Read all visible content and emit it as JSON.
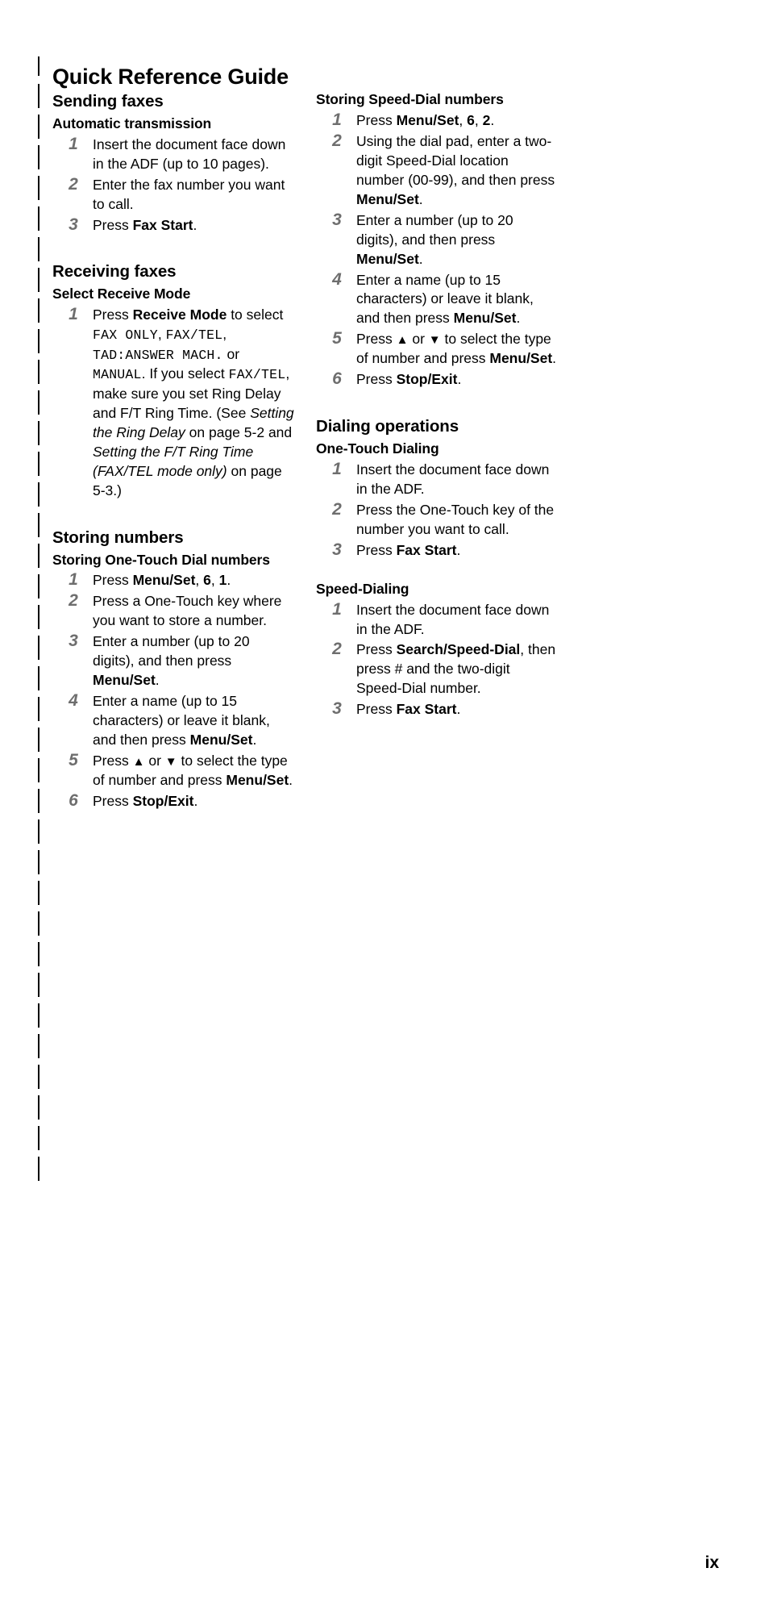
{
  "document": {
    "title": "Quick Reference Guide",
    "page_number": "ix"
  },
  "left_column": {
    "sections": [
      {
        "heading": "Sending faxes",
        "subheading": "Automatic transmission",
        "steps": [
          {
            "num": "1",
            "text": "Insert the document face down in the ADF (up to 10 pages)."
          },
          {
            "num": "2",
            "text": "Enter the fax number you want to call."
          },
          {
            "num": "3",
            "text": "Press Fax Start."
          }
        ]
      },
      {
        "heading": "Receiving faxes",
        "subheading": "Select Receive Mode",
        "steps": [
          {
            "num": "1",
            "text": "Press Receive Mode to select FAX ONLY, FAX/TEL, TAD:ANSWER MACH. or MANUAL. If you select FAX/TEL, make sure you set Ring Delay and F/T Ring Time. (See Setting the Ring Delay on page 5-2 and Setting the F/T Ring Time (FAX/TEL mode only) on page 5-3.)"
          }
        ]
      },
      {
        "heading": "Storing numbers",
        "subheading": "Storing One-Touch Dial numbers",
        "steps": [
          {
            "num": "1",
            "text": "Press Menu/Set, 6, 1."
          },
          {
            "num": "2",
            "text": "Press a One-Touch key where you want to store a number."
          },
          {
            "num": "3",
            "text": "Enter a number (up to 20 digits), and then press Menu/Set."
          },
          {
            "num": "4",
            "text": "Enter a name (up to 15 characters) or leave it blank, and then press Menu/Set."
          },
          {
            "num": "5",
            "text": "Press ▲ or ▼ to select the type of number and press Menu/Set."
          },
          {
            "num": "6",
            "text": "Press Stop/Exit."
          }
        ]
      }
    ]
  },
  "right_column": {
    "sections": [
      {
        "heading": "",
        "subheading": "Storing Speed-Dial numbers",
        "steps": [
          {
            "num": "1",
            "text": "Press Menu/Set, 6, 2."
          },
          {
            "num": "2",
            "text": "Using the dial pad, enter a two-digit Speed-Dial location number (00-99), and then press Menu/Set."
          },
          {
            "num": "3",
            "text": "Enter a number (up to 20 digits), and then press Menu/Set."
          },
          {
            "num": "4",
            "text": "Enter a name (up to 15 characters) or leave it blank, and then press Menu/Set."
          },
          {
            "num": "5",
            "text": "Press ▲ or ▼ to select the type of number and press Menu/Set."
          },
          {
            "num": "6",
            "text": "Press Stop/Exit."
          }
        ]
      },
      {
        "heading": "Dialing operations",
        "subheading": "One-Touch Dialing",
        "steps": [
          {
            "num": "1",
            "text": "Insert the document face down in the ADF."
          },
          {
            "num": "2",
            "text": "Press the One-Touch key of the number you want to call."
          },
          {
            "num": "3",
            "text": "Press Fax Start."
          }
        ]
      },
      {
        "heading": "",
        "subheading": "Speed-Dialing",
        "steps": [
          {
            "num": "1",
            "text": "Insert the document face down in the ADF."
          },
          {
            "num": "2",
            "text": "Press Search/Speed-Dial, then press # and the two-digit Speed-Dial number."
          },
          {
            "num": "3",
            "text": "Press Fax Start."
          }
        ]
      }
    ]
  },
  "labels": {
    "section_sending": "Sending faxes",
    "section_receiving": "Receiving faxes",
    "section_storing": "Storing numbers",
    "section_dialing": "Dialing operations",
    "sub_automatic": "Automatic transmission",
    "sub_select_receive": "Select Receive Mode",
    "sub_one_touch_store": "Storing One-Touch Dial numbers",
    "sub_speed_dial_store": "Storing Speed-Dial numbers",
    "sub_one_touch_dial": "One-Touch Dialing",
    "sub_speed_dialing": "Speed-Dialing"
  },
  "buttons": {
    "fax_start": "Fax Start",
    "receive_mode": "Receive Mode",
    "menu_set": "Menu/Set",
    "stop_exit": "Stop/Exit",
    "search_speed_dial": "Search/Speed-Dial"
  },
  "lcd_modes": {
    "fax_only": "FAX ONLY",
    "fax_tel": "FAX/TEL",
    "tad": "TAD:ANSWER MACH.",
    "manual": "MANUAL"
  },
  "cross_references": [
    {
      "title": "Setting the Ring Delay",
      "page": "5-2"
    },
    {
      "title": "Setting the F/T Ring Time (FAX/TEL mode only)",
      "page": "5-3"
    }
  ],
  "icons": {
    "up_triangle": "▲",
    "down_triangle": "▼"
  },
  "colors": {
    "step_number": "#6e6e6e",
    "text": "#000000",
    "background": "#ffffff"
  }
}
